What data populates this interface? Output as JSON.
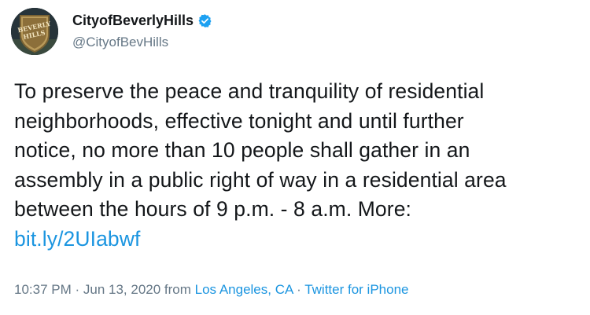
{
  "author": {
    "display_name": "CityofBeverlyHills",
    "handle": "@CityofBevHills",
    "verified": true,
    "avatar_icon": "beverly-hills-shield-logo"
  },
  "tweet": {
    "lines": [
      "To preserve the peace and tranquility of residential",
      "neighborhoods, effective tonight and until further",
      "notice, no more than 10 people shall gather in an",
      "assembly in a public right of way in a residential area",
      "between the hours of 9 p.m. - 8 a.m. More:"
    ],
    "link_text": "bit.ly/2UIabwf"
  },
  "meta": {
    "time_date": "10:37 PM · Jun 13, 2020 from ",
    "location": "Los Angeles, CA",
    "separator": " · ",
    "source": "Twitter for iPhone"
  },
  "colors": {
    "link": "#1b95e0",
    "muted": "#657786",
    "text": "#14171a",
    "verified_badge": "#1da1f2"
  }
}
